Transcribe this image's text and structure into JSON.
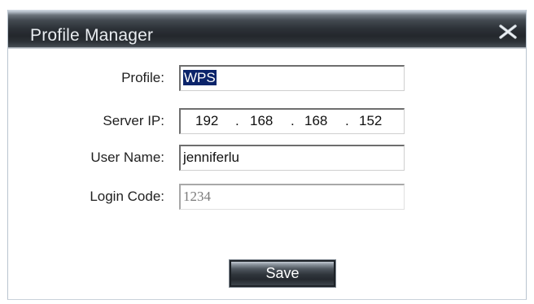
{
  "dialog": {
    "title": "Profile Manager",
    "close_icon": "close-x-icon"
  },
  "form": {
    "profile": {
      "label": "Profile:",
      "value": "WPS",
      "selected": true
    },
    "server_ip": {
      "label": "Server IP:",
      "octets": [
        "192",
        "168",
        "168",
        "152"
      ],
      "separator": "."
    },
    "user_name": {
      "label": "User Name:",
      "value": "jenniferlu"
    },
    "login_code": {
      "label": "Login Code:",
      "value": "1234",
      "disabled": true
    }
  },
  "actions": {
    "save_label": "Save"
  },
  "colors": {
    "titlebar_dark": "#23272c",
    "title_text": "#e9edf1",
    "selection_bg": "#0b246a"
  }
}
